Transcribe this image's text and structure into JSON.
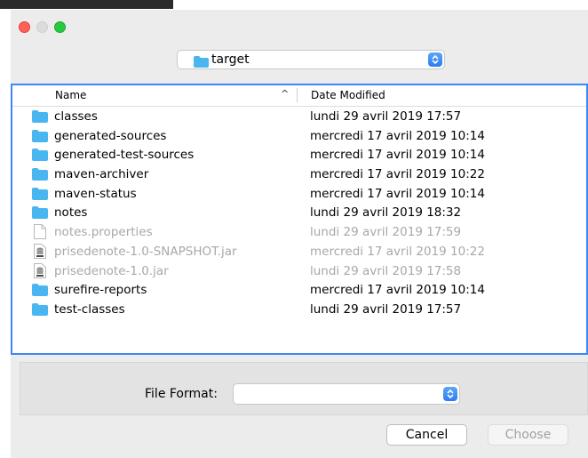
{
  "location": {
    "current": "target"
  },
  "columns": {
    "name": "Name",
    "sort_indicator": "^",
    "date": "Date Modified"
  },
  "files": [
    {
      "name": "classes",
      "date": "lundi 29 avril 2019 17:57",
      "kind": "folder",
      "enabled": true
    },
    {
      "name": "generated-sources",
      "date": "mercredi 17 avril 2019 10:14",
      "kind": "folder",
      "enabled": true
    },
    {
      "name": "generated-test-sources",
      "date": "mercredi 17 avril 2019 10:14",
      "kind": "folder",
      "enabled": true
    },
    {
      "name": "maven-archiver",
      "date": "mercredi 17 avril 2019 10:22",
      "kind": "folder",
      "enabled": true
    },
    {
      "name": "maven-status",
      "date": "mercredi 17 avril 2019 10:14",
      "kind": "folder",
      "enabled": true
    },
    {
      "name": "notes",
      "date": "lundi 29 avril 2019 18:32",
      "kind": "folder",
      "enabled": true
    },
    {
      "name": "notes.properties",
      "date": "lundi 29 avril 2019 17:59",
      "kind": "document",
      "enabled": false
    },
    {
      "name": "prisedenote-1.0-SNAPSHOT.jar",
      "date": "mercredi 17 avril 2019 10:22",
      "kind": "jar",
      "enabled": false
    },
    {
      "name": "prisedenote-1.0.jar",
      "date": "lundi 29 avril 2019 17:58",
      "kind": "jar",
      "enabled": false
    },
    {
      "name": "surefire-reports",
      "date": "mercredi 17 avril 2019 10:14",
      "kind": "folder",
      "enabled": true
    },
    {
      "name": "test-classes",
      "date": "lundi 29 avril 2019 17:57",
      "kind": "folder",
      "enabled": true
    }
  ],
  "format": {
    "label": "File Format:",
    "value": ""
  },
  "buttons": {
    "cancel": "Cancel",
    "choose": "Choose"
  },
  "colors": {
    "accent": "#3f87f5",
    "folder": "#49b6f0",
    "close": "#fe5f57",
    "zoom": "#28c840"
  }
}
